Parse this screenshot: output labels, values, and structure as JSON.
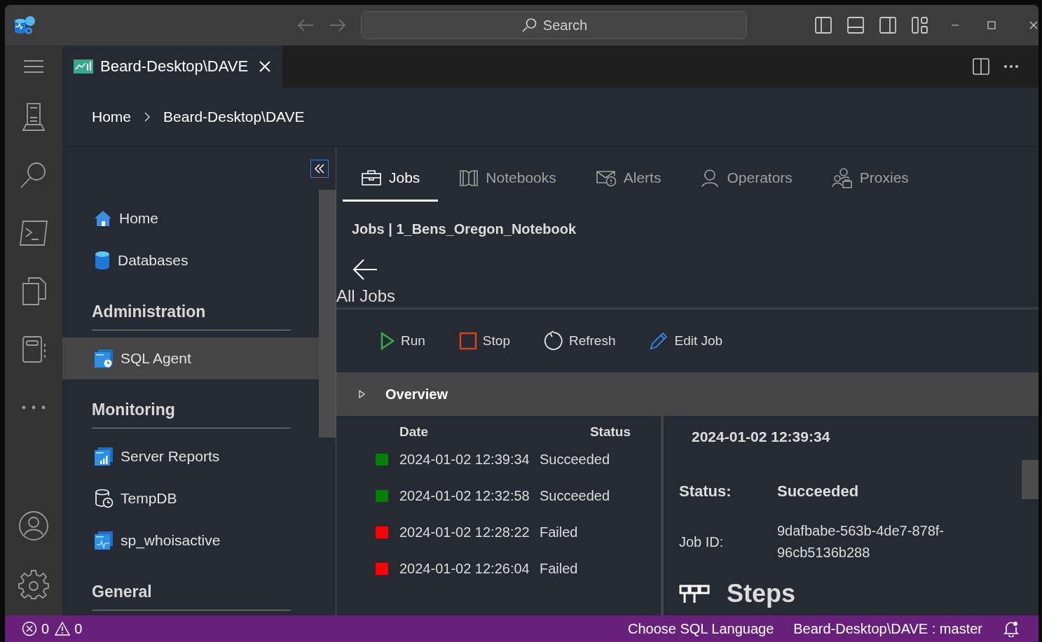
{
  "title_bar": {
    "search": {
      "placeholder": "Search"
    }
  },
  "editor_tab": {
    "title": "Beard-Desktop\\DAVE"
  },
  "breadcrumb": [
    "Home",
    "Beard-Desktop\\DAVE"
  ],
  "nav": {
    "sections": [
      {
        "items": [
          {
            "label": "Home",
            "kind": "home",
            "selected": false
          },
          {
            "label": "Databases",
            "kind": "database",
            "selected": false
          }
        ]
      },
      {
        "heading": "Administration",
        "items": [
          {
            "label": "SQL Agent",
            "kind": "sql-agent",
            "selected": true
          }
        ]
      },
      {
        "heading": "Monitoring",
        "items": [
          {
            "label": "Server Reports",
            "kind": "sql-reports",
            "selected": false
          },
          {
            "label": "TempDB",
            "kind": "tempdb",
            "selected": false
          },
          {
            "label": "sp_whoisactive",
            "kind": "sql-activity",
            "selected": false
          }
        ]
      },
      {
        "heading": "General"
      }
    ]
  },
  "agent_tabs": [
    {
      "label": "Jobs",
      "kind": "jobs",
      "selected": true
    },
    {
      "label": "Notebooks",
      "kind": "notebooks",
      "selected": false
    },
    {
      "label": "Alerts",
      "kind": "alerts",
      "selected": false
    },
    {
      "label": "Operators",
      "kind": "operators",
      "selected": false
    },
    {
      "label": "Proxies",
      "kind": "proxies",
      "selected": false
    }
  ],
  "job_title": "Jobs | 1_Bens_Oregon_Notebook",
  "back_label": "All Jobs",
  "toolbar": [
    {
      "label": "Run",
      "kind": "run"
    },
    {
      "label": "Stop",
      "kind": "stop"
    },
    {
      "label": "Refresh",
      "kind": "refresh"
    },
    {
      "label": "Edit Job",
      "kind": "edit"
    }
  ],
  "overview": {
    "title": "Overview",
    "expanded": false
  },
  "history": {
    "columns": [
      "Date",
      "Status"
    ],
    "rows": [
      {
        "date": "2024-01-02 12:39:34",
        "status": "Succeeded",
        "color": "#008000"
      },
      {
        "date": "2024-01-02 12:32:58",
        "status": "Succeeded",
        "color": "#008000"
      },
      {
        "date": "2024-01-02 12:28:22",
        "status": "Failed",
        "color": "#ff0000"
      },
      {
        "date": "2024-01-02 12:26:04",
        "status": "Failed",
        "color": "#ff0000"
      }
    ]
  },
  "detail": {
    "heading": "2024-01-02 12:39:34",
    "fields": [
      {
        "label": "Status:",
        "value": "Succeeded",
        "kind": "strong"
      },
      {
        "label": "Job ID:",
        "value": "9dafbabe-563b-4de7-878f-96cb5136b288",
        "kind": "plain"
      }
    ],
    "steps_heading": "Steps"
  },
  "status_bar": {
    "errors": "0",
    "warnings": "0",
    "items": [
      "Choose SQL Language",
      "Beard-Desktop\\DAVE : master"
    ]
  }
}
